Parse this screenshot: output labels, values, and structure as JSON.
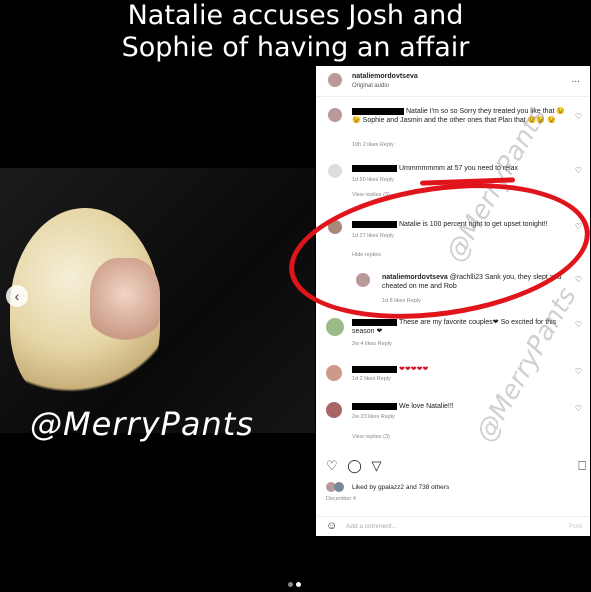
{
  "headline": {
    "line1": "Natalie accuses Josh and",
    "line2": "Sophie of having an affair"
  },
  "watermark": "@MerryPants",
  "post": {
    "username": "nataliemordovtseva",
    "subtitle": "Original audio",
    "more": "..."
  },
  "comments": [
    {
      "text": "Natalie I'm so so Sorry they treated you like that 😉😉 Sophie and Jasmin and the other ones that Plan that 😉😉 😉",
      "meta": "10h  2 likes  Reply"
    },
    {
      "text": "Ummmmmmm at 57 you need to relax",
      "meta": "1d  50 likes  Reply",
      "replies": "View replies (3)"
    },
    {
      "text": "Natalie is 100 percent right to get upset tonight!!",
      "meta": "1d  27 likes  Reply",
      "replies": "Hide replies"
    },
    {
      "user": "nataliemordovtseva",
      "text": "@rachlli23 Sank you, they slept and cheated on me and Rob",
      "meta": "1d  8 likes  Reply"
    },
    {
      "text": "These are my favorite couples❤ So excited for this season ❤",
      "meta": "2w  4 likes  Reply"
    },
    {
      "text": "❤❤❤❤❤",
      "meta": "1d  2 likes  Reply"
    },
    {
      "text": "We love Natalie!!!",
      "meta": "2w  23 likes  Reply",
      "replies": "View replies (3)"
    }
  ],
  "likes": "Liked by gpalazz2 and 738 others",
  "date": "December 4",
  "add_comment": {
    "placeholder": "Add a comment...",
    "post": "Post"
  },
  "icons": [
    "heart-icon",
    "comment-icon",
    "share-icon",
    "bookmark-icon"
  ]
}
